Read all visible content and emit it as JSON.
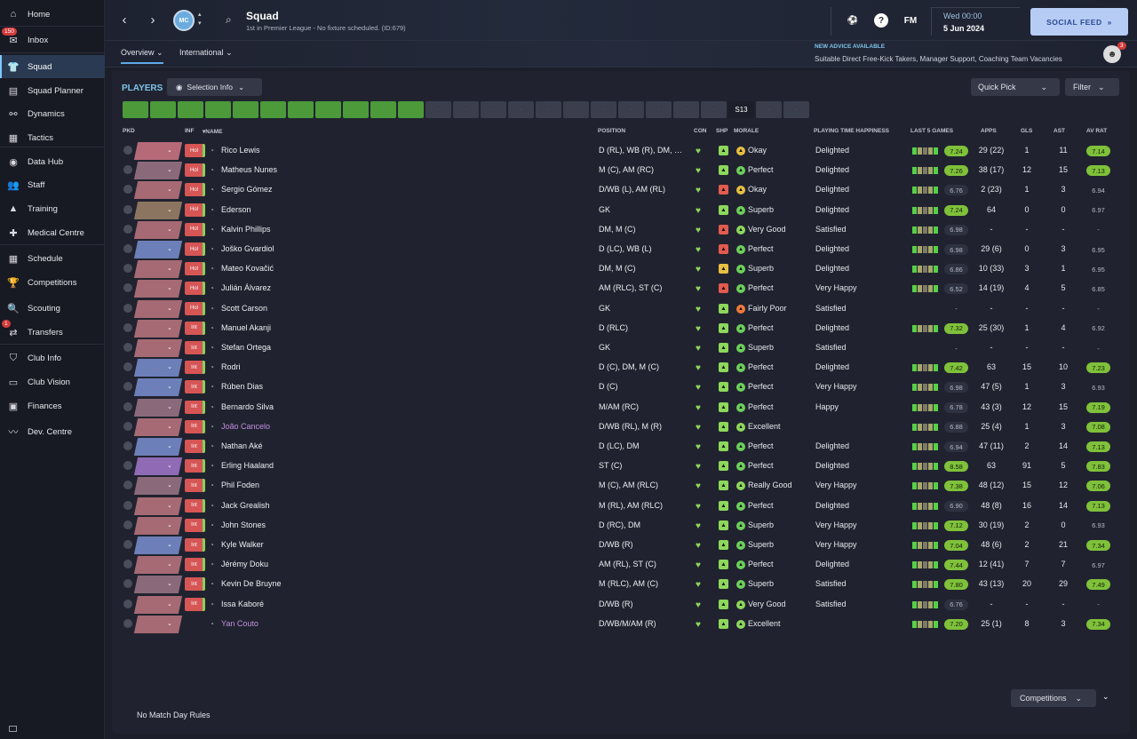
{
  "sidebar": {
    "items": [
      {
        "label": "Home",
        "icon": "home-icon",
        "glyph": "⌂"
      },
      {
        "label": "Inbox",
        "icon": "inbox-icon",
        "glyph": "✉",
        "badge": "150"
      },
      {
        "label": "Squad",
        "icon": "shirt-icon",
        "glyph": "👕",
        "active": true
      },
      {
        "label": "Squad Planner",
        "icon": "clipboard-icon",
        "glyph": "▤"
      },
      {
        "label": "Dynamics",
        "icon": "dynamics-icon",
        "glyph": "⚯"
      },
      {
        "label": "Tactics",
        "icon": "tactics-icon",
        "glyph": "▦"
      },
      {
        "label": "Data Hub",
        "icon": "data-hub-icon",
        "glyph": "◉"
      },
      {
        "label": "Staff",
        "icon": "staff-icon",
        "glyph": "👥"
      },
      {
        "label": "Training",
        "icon": "training-icon",
        "glyph": "▲"
      },
      {
        "label": "Medical Centre",
        "icon": "medical-icon",
        "glyph": "✚"
      },
      {
        "label": "Schedule",
        "icon": "calendar-icon",
        "glyph": "▦"
      },
      {
        "label": "Competitions",
        "icon": "trophy-icon",
        "glyph": "🏆"
      },
      {
        "label": "Scouting",
        "icon": "scouting-icon",
        "glyph": "🔍"
      },
      {
        "label": "Transfers",
        "icon": "transfers-icon",
        "glyph": "⇄",
        "badge": "1"
      },
      {
        "label": "Club Info",
        "icon": "shield-icon",
        "glyph": "⛉"
      },
      {
        "label": "Club Vision",
        "icon": "vision-icon",
        "glyph": "▭"
      },
      {
        "label": "Finances",
        "icon": "finances-icon",
        "glyph": "▣"
      },
      {
        "label": "Dev. Centre",
        "icon": "dev-centre-icon",
        "glyph": "〰"
      }
    ]
  },
  "topbar": {
    "title": "Squad",
    "subtitle": "1st in Premier League - No fixture scheduled. (ID:679)",
    "date_day": "Wed 00:00",
    "date_date": "5 Jun 2024",
    "social_feed": "SOCIAL FEED",
    "fm": "FM"
  },
  "subbar": {
    "tab_overview": "Overview",
    "tab_international": "International",
    "advice_title": "NEW ADVICE AVAILABLE",
    "advice_text": "Suitable Direct Free-Kick Takers, Manager Support, Coaching Team Vacancies",
    "advice_badge": "3"
  },
  "toolbar": {
    "players": "PLAYERS",
    "selection_info": "Selection Info",
    "quick_pick": "Quick Pick",
    "filter": "Filter"
  },
  "slot_bar": {
    "active_slot": "S13"
  },
  "columns": {
    "pkd": "PKD",
    "inf": "INF",
    "name": "NAME",
    "position": "POSITION",
    "con": "CON",
    "shp": "SHP",
    "morale": "MORALE",
    "pth": "PLAYING TIME HAPPINESS",
    "last5": "LAST 5 GAMES",
    "apps": "APPS",
    "gls": "GLS",
    "ast": "AST",
    "avrat": "AV RAT"
  },
  "players": [
    {
      "name": "Rico Lewis",
      "inf": "Hol",
      "position": "D (RL), WB (R), DM, M (C)",
      "morale": "Okay",
      "pth": "Delighted",
      "last5": "7.24",
      "apps": "29 (22)",
      "gls": "1",
      "ast": "11",
      "avrat": "7.14"
    },
    {
      "name": "Matheus Nunes",
      "inf": "Hol",
      "position": "M (C), AM (RC)",
      "morale": "Perfect",
      "pth": "Delighted",
      "last5": "7.26",
      "apps": "38 (17)",
      "gls": "12",
      "ast": "15",
      "avrat": "7.13"
    },
    {
      "name": "Sergio Gómez",
      "inf": "Hol",
      "position": "D/WB (L), AM (RL)",
      "morale": "Okay",
      "pth": "Delighted",
      "last5": "6.76",
      "apps": "2 (23)",
      "gls": "1",
      "ast": "3",
      "avrat": "6.94"
    },
    {
      "name": "Ederson",
      "inf": "Hol",
      "position": "GK",
      "morale": "Superb",
      "pth": "Delighted",
      "last5": "7.24",
      "apps": "64",
      "gls": "0",
      "ast": "0",
      "avrat": "6.97"
    },
    {
      "name": "Kalvin Phillips",
      "inf": "Hol",
      "position": "DM, M (C)",
      "morale": "Very Good",
      "pth": "Satisfied",
      "last5": "6.98",
      "apps": "-",
      "gls": "-",
      "ast": "-",
      "avrat": "-"
    },
    {
      "name": "Joško Gvardiol",
      "inf": "Hol",
      "position": "D (LC), WB (L)",
      "morale": "Perfect",
      "pth": "Delighted",
      "last5": "6.98",
      "apps": "29 (6)",
      "gls": "0",
      "ast": "3",
      "avrat": "6.95"
    },
    {
      "name": "Mateo Kovačić",
      "inf": "Hol",
      "position": "DM, M (C)",
      "morale": "Superb",
      "pth": "Delighted",
      "last5": "6.86",
      "apps": "10 (33)",
      "gls": "3",
      "ast": "1",
      "avrat": "6.95"
    },
    {
      "name": "Julián Álvarez",
      "inf": "Hol",
      "position": "AM (RLC), ST (C)",
      "morale": "Perfect",
      "pth": "Very Happy",
      "last5": "6.52",
      "apps": "14 (19)",
      "gls": "4",
      "ast": "5",
      "avrat": "6.85"
    },
    {
      "name": "Scott Carson",
      "inf": "Hol",
      "position": "GK",
      "morale": "Fairly Poor",
      "pth": "Satisfied",
      "last5": "-",
      "apps": "-",
      "gls": "-",
      "ast": "-",
      "avrat": "-"
    },
    {
      "name": "Manuel Akanji",
      "inf": "Int",
      "position": "D (RLC)",
      "morale": "Perfect",
      "pth": "Delighted",
      "last5": "7.32",
      "apps": "25 (30)",
      "gls": "1",
      "ast": "4",
      "avrat": "6.92"
    },
    {
      "name": "Stefan Ortega",
      "inf": "Int",
      "position": "GK",
      "morale": "Superb",
      "pth": "Satisfied",
      "last5": "-",
      "apps": "-",
      "gls": "-",
      "ast": "-",
      "avrat": "-"
    },
    {
      "name": "Rodri",
      "inf": "Int",
      "position": "D (C), DM, M (C)",
      "morale": "Perfect",
      "pth": "Delighted",
      "last5": "7.42",
      "apps": "63",
      "gls": "15",
      "ast": "10",
      "avrat": "7.23"
    },
    {
      "name": "Rúben Dias",
      "inf": "Int",
      "position": "D (C)",
      "morale": "Perfect",
      "pth": "Very Happy",
      "last5": "6.98",
      "apps": "47 (5)",
      "gls": "1",
      "ast": "3",
      "avrat": "6.93"
    },
    {
      "name": "Bernardo Silva",
      "inf": "Int",
      "position": "M/AM (RC)",
      "morale": "Perfect",
      "pth": "Happy",
      "last5": "6.78",
      "apps": "43 (3)",
      "gls": "12",
      "ast": "15",
      "avrat": "7.19"
    },
    {
      "name": "João Cancelo",
      "inf": "Int",
      "position": "D/WB (RL), M (R)",
      "morale": "Excellent",
      "pth": "",
      "last5": "6.88",
      "apps": "25 (4)",
      "gls": "1",
      "ast": "3",
      "avrat": "7.08",
      "loan": true
    },
    {
      "name": "Nathan Aké",
      "inf": "Int",
      "position": "D (LC), DM",
      "morale": "Perfect",
      "pth": "Delighted",
      "last5": "6.94",
      "apps": "47 (11)",
      "gls": "2",
      "ast": "14",
      "avrat": "7.13"
    },
    {
      "name": "Erling Haaland",
      "inf": "Int",
      "position": "ST (C)",
      "morale": "Perfect",
      "pth": "Delighted",
      "last5": "8.58",
      "apps": "63",
      "gls": "91",
      "ast": "5",
      "avrat": "7.83"
    },
    {
      "name": "Phil Foden",
      "inf": "Int",
      "position": "M (C), AM (RLC)",
      "morale": "Really Good",
      "pth": "Very Happy",
      "last5": "7.38",
      "apps": "48 (12)",
      "gls": "15",
      "ast": "12",
      "avrat": "7.06"
    },
    {
      "name": "Jack Grealish",
      "inf": "Int",
      "position": "M (RL), AM (RLC)",
      "morale": "Perfect",
      "pth": "Delighted",
      "last5": "6.90",
      "apps": "48 (8)",
      "gls": "16",
      "ast": "14",
      "avrat": "7.13"
    },
    {
      "name": "John Stones",
      "inf": "Int",
      "position": "D (RC), DM",
      "morale": "Superb",
      "pth": "Very Happy",
      "last5": "7.12",
      "apps": "30 (19)",
      "gls": "2",
      "ast": "0",
      "avrat": "6.93"
    },
    {
      "name": "Kyle Walker",
      "inf": "Int",
      "position": "D/WB (R)",
      "morale": "Superb",
      "pth": "Very Happy",
      "last5": "7.04",
      "apps": "48 (6)",
      "gls": "2",
      "ast": "21",
      "avrat": "7.34"
    },
    {
      "name": "Jérémy Doku",
      "inf": "Int",
      "position": "AM (RL), ST (C)",
      "morale": "Perfect",
      "pth": "Delighted",
      "last5": "7.44",
      "apps": "12 (41)",
      "gls": "7",
      "ast": "7",
      "avrat": "6.97"
    },
    {
      "name": "Kevin De Bruyne",
      "inf": "Int",
      "position": "M (RLC), AM (C)",
      "morale": "Superb",
      "pth": "Satisfied",
      "last5": "7.80",
      "apps": "43 (13)",
      "gls": "20",
      "ast": "29",
      "avrat": "7.49"
    },
    {
      "name": "Issa Kaboré",
      "inf": "Int",
      "position": "D/WB (R)",
      "morale": "Very Good",
      "pth": "Satisfied",
      "last5": "6.76",
      "apps": "-",
      "gls": "-",
      "ast": "-",
      "avrat": "-"
    },
    {
      "name": "Yan Couto",
      "inf": "",
      "position": "D/WB/M/AM (R)",
      "morale": "Excellent",
      "pth": "",
      "last5": "7.20",
      "apps": "25 (1)",
      "gls": "8",
      "ast": "3",
      "avrat": "7.34",
      "loan": true
    }
  ],
  "footer": {
    "competitions": "Competitions",
    "match_rules": "No Match Day Rules"
  }
}
